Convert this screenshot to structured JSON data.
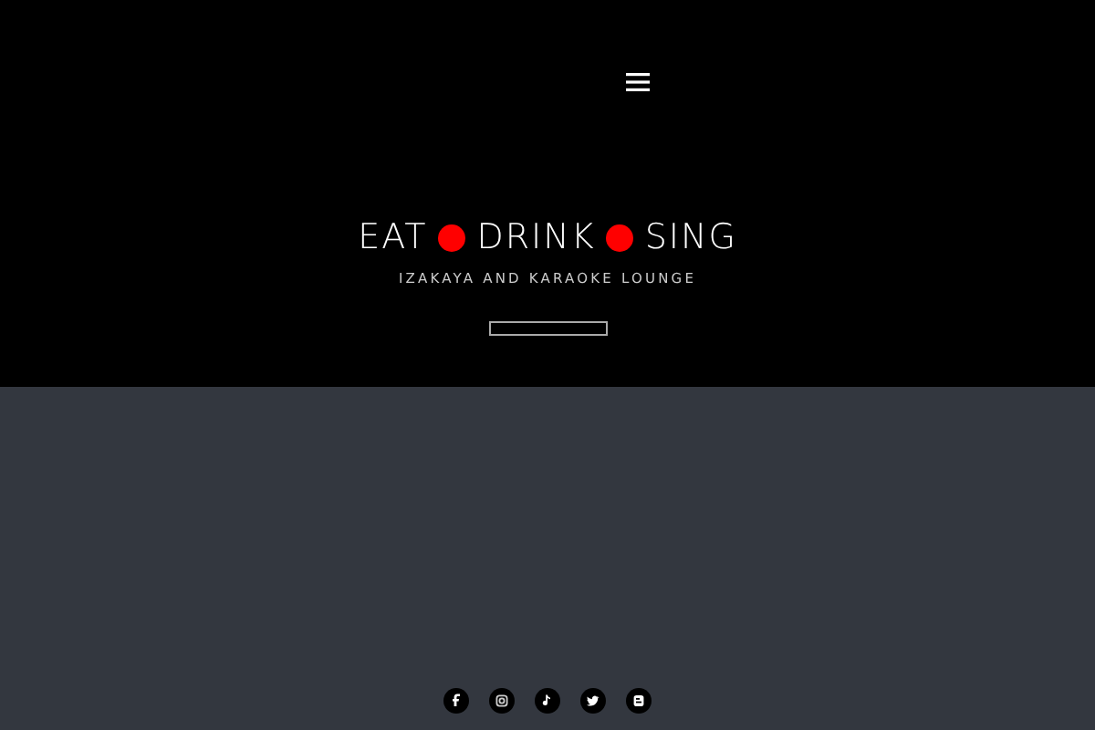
{
  "hero": {
    "title_words": [
      "EAT",
      "DRINK",
      "SING"
    ],
    "subtitle": "IZAKAYA AND KARAOKE LOUNGE"
  }
}
